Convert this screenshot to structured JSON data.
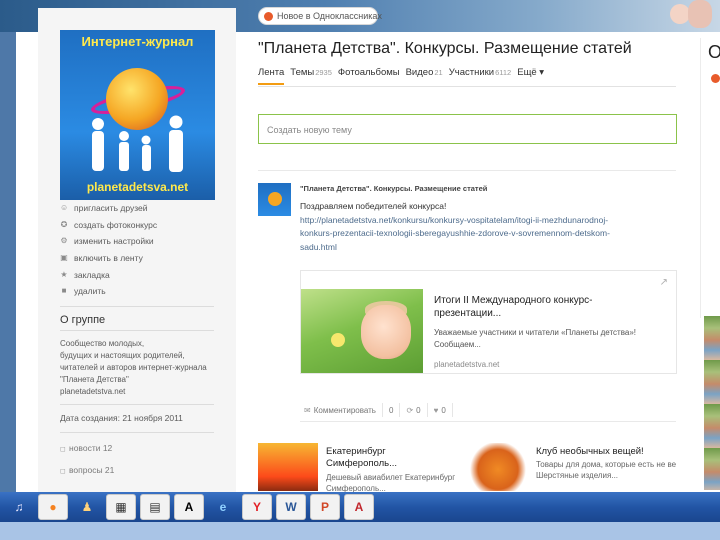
{
  "top_notice": "Новое в Одноклассниках",
  "sidebar": {
    "logo_title": "Интернет-журнал",
    "logo_url": "planetadetsva.net",
    "menu": [
      {
        "label": "пригласить друзей",
        "icon": "people-icon"
      },
      {
        "label": "создать фотоконкурс",
        "icon": "medal-icon"
      },
      {
        "label": "изменить настройки",
        "icon": "gear-icon"
      },
      {
        "label": "включить в ленту",
        "icon": "feed-icon"
      },
      {
        "label": "закладка",
        "icon": "star-icon"
      },
      {
        "label": "удалить",
        "icon": "lock-icon"
      }
    ],
    "about_title": "О группе",
    "about_lines": [
      "Сообщество молодых,",
      "будущих и настоящих родителей,",
      "читателей и авторов интернет-журнала",
      "\"Планета Детства\"",
      "planetadetstva.net"
    ],
    "created": "Дата создания: 21 ноября 2011",
    "stats": [
      "новости 12",
      "вопросы 21"
    ]
  },
  "main": {
    "title": "\"Планета Детства\". Конкурсы. Размещение статей",
    "tabs": [
      {
        "label": "Лента",
        "count": ""
      },
      {
        "label": "Темы",
        "count": "2935"
      },
      {
        "label": "Фотоальбомы",
        "count": ""
      },
      {
        "label": "Видео",
        "count": "21"
      },
      {
        "label": "Участники",
        "count": "6112"
      },
      {
        "label": "Ещё ▾",
        "count": ""
      }
    ],
    "new_topic_placeholder": "Создать новую тему",
    "post": {
      "author": "\"Планета Детства\". Конкурсы. Размещение статей",
      "text_line1": "Поздравляем победителей конкурса!",
      "link_lines": [
        "http://planetadetstva.net/konkursu/konkursy-vospitatelam/itogi-ii-mezhdunarodnoj-",
        "konkurs-prezentacii-texnologii-sberegayushhie-zdorove-v-sovremennom-detskom-",
        "sadu.html"
      ],
      "card": {
        "title_lines": [
          "Итоги II Международного конкурс-",
          "презентации..."
        ],
        "desc_lines": [
          "Уважаемые участники и читатели «Планеты детства»!",
          "Сообщаем..."
        ],
        "site": "planetadetstva.net"
      },
      "actions": [
        {
          "label": "Комментировать",
          "count": "0",
          "icon": "comment-icon"
        },
        {
          "label": "",
          "count": "0",
          "icon": "reshare-icon"
        },
        {
          "label": "",
          "count": "0",
          "icon": "like-icon"
        }
      ]
    },
    "recommended": [
      {
        "title_lines": [
          "Екатеринбург",
          "Симферополь..."
        ],
        "desc_lines": [
          "Дешевый авиабилет Екатеринбург",
          "Симферополь..."
        ]
      },
      {
        "title_lines": [
          "Клуб необычных вещей!",
          ""
        ],
        "desc_lines": [
          "Товары для дома, которые есть не везде...",
          "Шерстяные изделия..."
        ]
      }
    ]
  },
  "right_col": {
    "letter": "О"
  },
  "taskbar": {
    "apps": [
      {
        "name": "itunes-icon",
        "glyph": "♫",
        "color": "#e8e8ff"
      },
      {
        "name": "firefox-icon",
        "glyph": "●",
        "color": "#f58220"
      },
      {
        "name": "people-app-icon",
        "glyph": "♟",
        "color": "#ffd27a"
      },
      {
        "name": "calculator-icon",
        "glyph": "▦",
        "color": "#333333"
      },
      {
        "name": "document-icon",
        "glyph": "▤",
        "color": "#333333"
      },
      {
        "name": "font-icon",
        "glyph": "A",
        "color": "#000000"
      },
      {
        "name": "ie-icon",
        "glyph": "e",
        "color": "#2d8cf0"
      },
      {
        "name": "yandex-icon",
        "glyph": "Y",
        "color": "#e31e24"
      },
      {
        "name": "word-icon",
        "glyph": "W",
        "color": "#2b5797"
      },
      {
        "name": "powerpoint-icon",
        "glyph": "P",
        "color": "#d24726"
      },
      {
        "name": "pdf-icon",
        "glyph": "A",
        "color": "#c1272d"
      }
    ]
  }
}
